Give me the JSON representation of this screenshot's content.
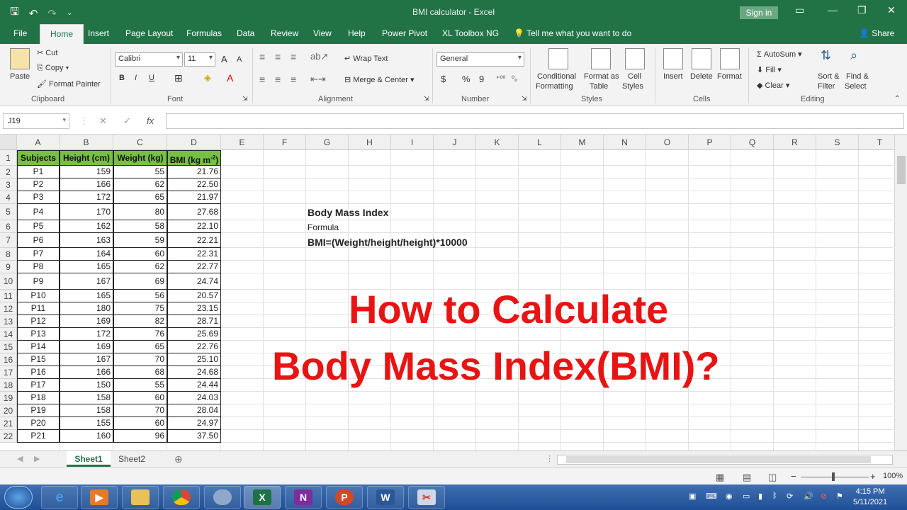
{
  "window": {
    "title": "BMI calculator - Excel",
    "sign_in": "Sign in"
  },
  "qat": {
    "save_icon": "save-icon",
    "undo_icon": "undo-icon",
    "redo_icon": "redo-icon",
    "customize_icon": "customize-icon"
  },
  "tabs": [
    "File",
    "Home",
    "Insert",
    "Page Layout",
    "Formulas",
    "Data",
    "Review",
    "View",
    "Help",
    "Power Pivot",
    "XL Toolbox NG"
  ],
  "tell_me": "Tell me what you want to do",
  "share": "Share",
  "ribbon": {
    "clipboard": {
      "paste": "Paste",
      "cut": "Cut",
      "copy": "Copy",
      "format_painter": "Format Painter",
      "label": "Clipboard"
    },
    "font": {
      "name": "Calibri",
      "size": "11",
      "grow": "A",
      "shrink": "A",
      "bold": "B",
      "italic": "I",
      "underline": "U",
      "label": "Font"
    },
    "alignment": {
      "wrap_text": "Wrap Text",
      "merge_center": "Merge & Center",
      "label": "Alignment"
    },
    "number": {
      "format": "General",
      "currency": "$",
      "percent": "%",
      "comma": "9",
      "label": "Number"
    },
    "styles": {
      "conditional": "Conditional",
      "conditional2": "Formatting",
      "format_as": "Format as",
      "table": "Table",
      "cell": "Cell",
      "cell_styles": "Styles",
      "label": "Styles"
    },
    "cells": {
      "insert": "Insert",
      "delete": "Delete",
      "format": "Format",
      "label": "Cells"
    },
    "editing": {
      "autosum": "AutoSum",
      "fill": "Fill",
      "clear": "Clear",
      "sort": "Sort &",
      "filter": "Filter",
      "find": "Find &",
      "select": "Select",
      "label": "Editing"
    }
  },
  "formula_bar": {
    "name_box": "J19",
    "fx": "fx",
    "cancel": "✕",
    "enter": "✓",
    "content": ""
  },
  "columns": [
    "A",
    "B",
    "C",
    "D",
    "E",
    "F",
    "G",
    "H",
    "I",
    "J",
    "K",
    "L",
    "M",
    "N",
    "O",
    "P",
    "Q",
    "R",
    "S",
    "T"
  ],
  "rows": [
    "1",
    "2",
    "3",
    "4",
    "5",
    "6",
    "7",
    "8",
    "9",
    "10",
    "11",
    "12",
    "13",
    "14",
    "15",
    "16",
    "17",
    "18",
    "19",
    "20",
    "21",
    "22"
  ],
  "table": {
    "headers": [
      "Subjects",
      "Height (cm)",
      "Weight (kg)",
      "BMI (kg m-2)"
    ],
    "rows": [
      [
        "P1",
        "159",
        "55",
        "21.76"
      ],
      [
        "P2",
        "166",
        "62",
        "22.50"
      ],
      [
        "P3",
        "172",
        "65",
        "21.97"
      ],
      [
        "P4",
        "170",
        "80",
        "27.68"
      ],
      [
        "P5",
        "162",
        "58",
        "22.10"
      ],
      [
        "P6",
        "163",
        "59",
        "22.21"
      ],
      [
        "P7",
        "164",
        "60",
        "22.31"
      ],
      [
        "P8",
        "165",
        "62",
        "22.77"
      ],
      [
        "P9",
        "167",
        "69",
        "24.74"
      ],
      [
        "P10",
        "165",
        "56",
        "20.57"
      ],
      [
        "P11",
        "180",
        "75",
        "23.15"
      ],
      [
        "P12",
        "169",
        "82",
        "28.71"
      ],
      [
        "P13",
        "172",
        "76",
        "25.69"
      ],
      [
        "P14",
        "169",
        "65",
        "22.76"
      ],
      [
        "P15",
        "167",
        "70",
        "25.10"
      ],
      [
        "P16",
        "166",
        "68",
        "24.68"
      ],
      [
        "P17",
        "150",
        "55",
        "24.44"
      ],
      [
        "P18",
        "158",
        "60",
        "24.03"
      ],
      [
        "P19",
        "158",
        "70",
        "28.04"
      ],
      [
        "P20",
        "155",
        "60",
        "24.97"
      ],
      [
        "P21",
        "160",
        "96",
        "37.50"
      ]
    ]
  },
  "notes": {
    "title": "Body Mass Index",
    "formula_label": "Formula",
    "formula": "BMI=(Weight/height/height)*10000"
  },
  "overlay": {
    "line1": "How to Calculate",
    "line2": "Body Mass Index(BMI)?",
    "color": "#e81414"
  },
  "sheets": [
    "Sheet1",
    "Sheet2"
  ],
  "status": {
    "zoom": "100%"
  },
  "taskbar": {
    "apps": [
      "start-icon",
      "ie-icon",
      "media-player-icon",
      "file-explorer-icon",
      "chrome-icon",
      "app-icon",
      "excel-icon",
      "onenote-icon",
      "powerpoint-icon",
      "word-icon",
      "snipping-tool-icon"
    ],
    "time": "4:15 PM",
    "date": "5/11/2021"
  },
  "colors": {
    "excel_green": "#217346",
    "header_fill": "#77c043"
  }
}
